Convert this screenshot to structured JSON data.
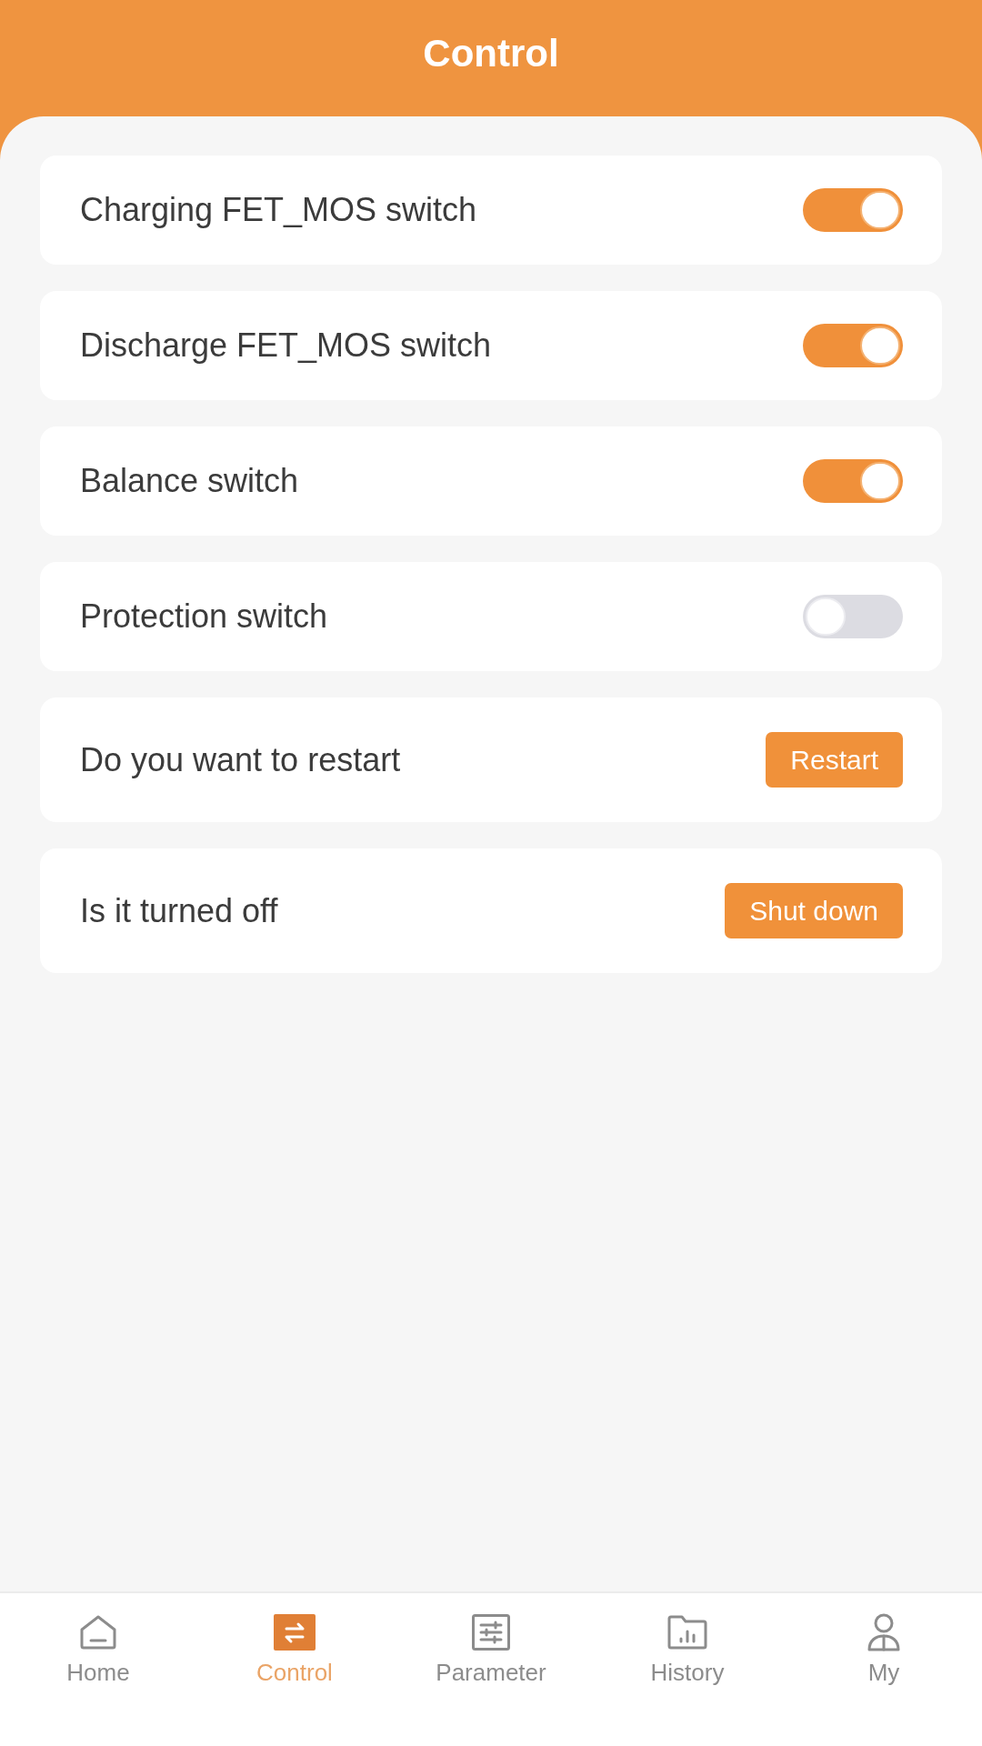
{
  "header": {
    "title": "Control"
  },
  "rows": [
    {
      "kind": "switch",
      "label": "Charging FET_MOS switch",
      "on": true
    },
    {
      "kind": "switch",
      "label": "Discharge FET_MOS switch",
      "on": true
    },
    {
      "kind": "switch",
      "label": "Balance switch",
      "on": true
    },
    {
      "kind": "switch",
      "label": "Protection switch",
      "on": false
    },
    {
      "kind": "button",
      "label": "Do you want to restart",
      "button": "Restart"
    },
    {
      "kind": "button",
      "label": "Is it turned off",
      "button": "Shut down"
    }
  ],
  "nav": [
    {
      "label": "Home",
      "selected": false
    },
    {
      "label": "Control",
      "selected": true
    },
    {
      "label": "Parameter",
      "selected": false
    },
    {
      "label": "History",
      "selected": false
    },
    {
      "label": "My",
      "selected": false
    }
  ]
}
